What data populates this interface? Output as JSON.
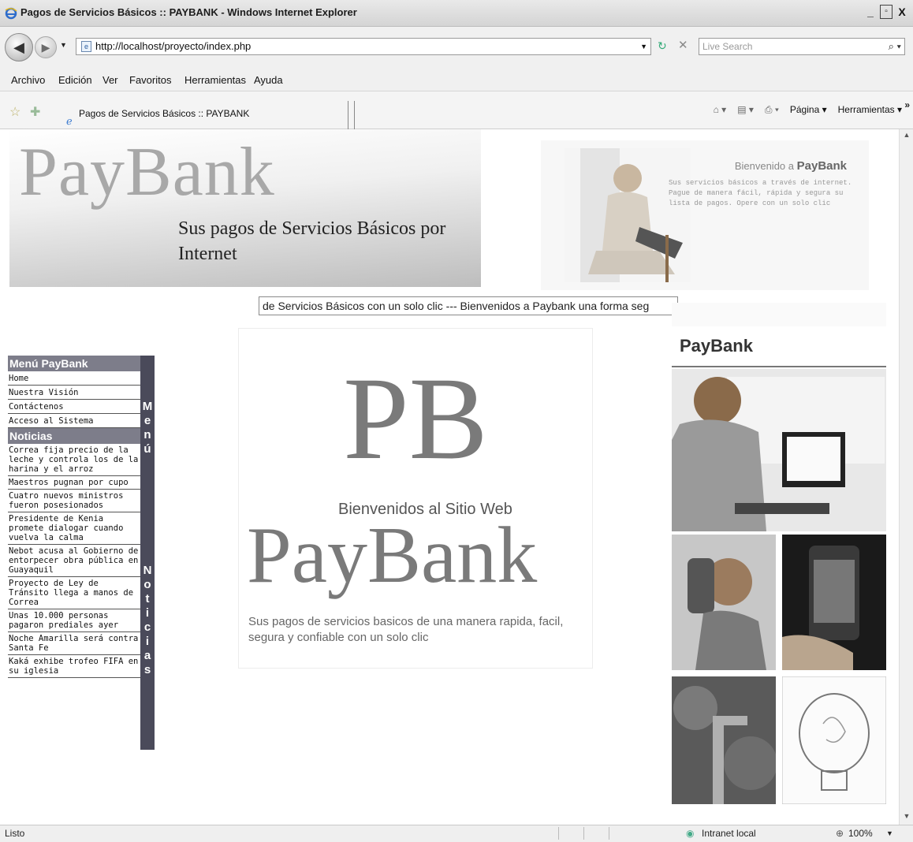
{
  "window": {
    "title": "Pagos de Servicios Básicos :: PAYBANK - Windows Internet Explorer",
    "controls": [
      "_",
      "▫",
      "X"
    ]
  },
  "address": {
    "url": "http://localhost/proyecto/index.php",
    "search_placeholder": "Live Search"
  },
  "menu": [
    "Archivo",
    "Edición",
    "Ver",
    "Favoritos",
    "Herramientas",
    "Ayuda"
  ],
  "tab": {
    "title": "Pagos de Servicios Básicos :: PAYBANK"
  },
  "toolbar": {
    "page_label": "Página",
    "tools_label": "Herramientas"
  },
  "header": {
    "logo": "PayBank",
    "slogan": "Sus pagos de Servicios Básicos por Internet",
    "mini_title_prefix": "Bienvenido a",
    "mini_title_brand": "PayBank",
    "mini_body": "Sus servicios básicos a través de internet. Pague de manera fácil, rápida y segura su lista de pagos. Opere con un solo clic"
  },
  "marquee": {
    "text": "de Servicios Básicos con un solo clic --- Bienvenidos a Paybank una forma seg"
  },
  "sidebar": {
    "menu_title": "Menú PayBank",
    "menu_items": [
      "Home",
      "Nuestra Visión",
      "Contáctenos",
      "Acceso al Sistema"
    ],
    "news_title": "Noticias",
    "news_items": [
      "Correa fija precio de la leche y controla los de la harina y el arroz",
      "Maestros pugnan por cupo",
      "Cuatro nuevos ministros fueron posesionados",
      "Presidente de Kenia promete dialogar cuando vuelva la calma",
      "Nebot acusa al Gobierno de entorpecer obra pública en Guayaquil",
      "Proyecto de Ley de Tránsito llega a manos de Correa",
      "Unas 10.000 personas pagaron prediales ayer",
      "Noche Amarilla será contra Santa Fe",
      "Kaká exhibe trofeo FIFA en su iglesia"
    ],
    "vertical_menu": [
      "M",
      "e",
      "n",
      "ú"
    ],
    "vertical_news": [
      "N",
      "o",
      "t",
      "i",
      "c",
      "i",
      "a",
      "s"
    ]
  },
  "center": {
    "monogram": "PB",
    "welcome": "Bienvenidos al Sitio Web",
    "brand": "PayBank",
    "description": "Sus pagos de servicios basicos de una manera rapida, facil, segura y confiable con un solo clic"
  },
  "right_column": {
    "header": "PayBank"
  },
  "status": {
    "left": "Listo",
    "zone": "Intranet local",
    "zoom": "100%"
  },
  "colors": {
    "sidebar_bar": "#4a4a5a",
    "section_head": "#7d7d8a",
    "logo_gray": "#a8a8a8"
  }
}
